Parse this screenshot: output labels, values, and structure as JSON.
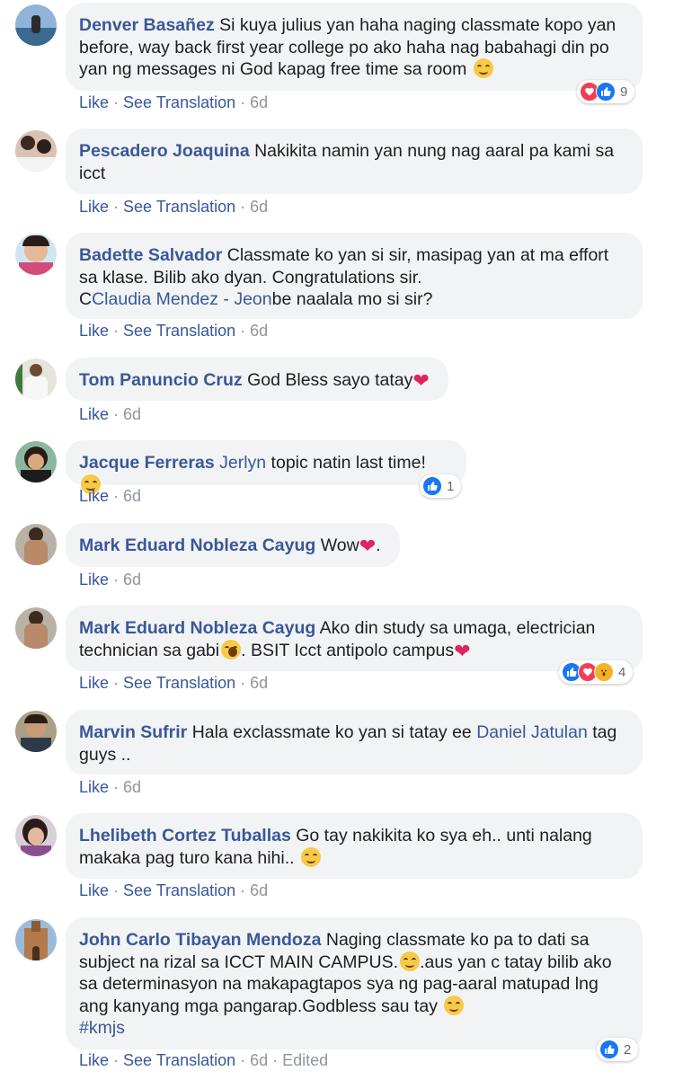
{
  "actions": {
    "like": "Like",
    "see_translation": "See Translation",
    "edited": "Edited",
    "sep": "·"
  },
  "comments": [
    {
      "author": "Denver Basañez",
      "text": "Si kuya julius yan haha naging classmate kopo yan before, way back first year college po ako haha nag babahagi din po yan ng messages ni God kapag free time sa room",
      "time": "6d",
      "reaction_count": "9",
      "reactions": [
        "heart-icon",
        "like-icon"
      ]
    },
    {
      "author": "Pescadero Joaquina",
      "text": "Nakikita namin yan nung nag aaral pa kami sa icct",
      "time": "6d"
    },
    {
      "author": "Badette Salvador",
      "text": "Classmate ko yan si sir, masipag yan at ma effort sa klase. Bilib ako dyan. Congratulations sir.",
      "text_prefix": "C",
      "mention": "Claudia Mendez - Jeon",
      "text_suffix": "be naalala mo si sir?",
      "time": "6d"
    },
    {
      "author": "Tom Panuncio Cruz",
      "text": "God Bless sayo tatay",
      "time": "6d"
    },
    {
      "author": "Jacque Ferreras",
      "mention": "Jerlyn",
      "text": " topic natin last time!",
      "time": "6d",
      "reaction_count": "1",
      "reactions": [
        "like-icon"
      ]
    },
    {
      "author": "Mark Eduard Nobleza Cayug",
      "text": "Wow",
      "text_suffix": ".",
      "time": "6d"
    },
    {
      "author": "Mark Eduard Nobleza Cayug",
      "text": "Ako din study sa umaga, electrician technician sa gabi",
      "text_suffix": ". BSIT Icct antipolo campus",
      "time": "6d",
      "reaction_count": "4",
      "reactions": [
        "like-icon",
        "heart-icon",
        "wow-icon"
      ]
    },
    {
      "author": "Marvin Sufrir",
      "text": "Hala exclassmate ko yan si tatay ee ",
      "mention": "Daniel Jatulan",
      "text_suffix": " tag guys ..",
      "time": "6d"
    },
    {
      "author": "Lhelibeth Cortez Tuballas",
      "text": "Go tay nakikita ko sya eh.. unti nalang makaka pag turo kana hihi..",
      "time": "6d"
    },
    {
      "author": "John Carlo Tibayan Mendoza",
      "text": "Naging classmate ko pa to dati sa subject na rizal sa ICCT MAIN CAMPUS.",
      "text_suffix": ".aus yan c tatay bilib ako sa determinasyon na makapagtapos sya ng pag-aaral matupad lng ang kanyang mga pangarap.Godbless sau tay",
      "hashtag": "#kmjs",
      "time": "6d",
      "reaction_count": "2",
      "reactions": [
        "like-icon"
      ]
    }
  ]
}
